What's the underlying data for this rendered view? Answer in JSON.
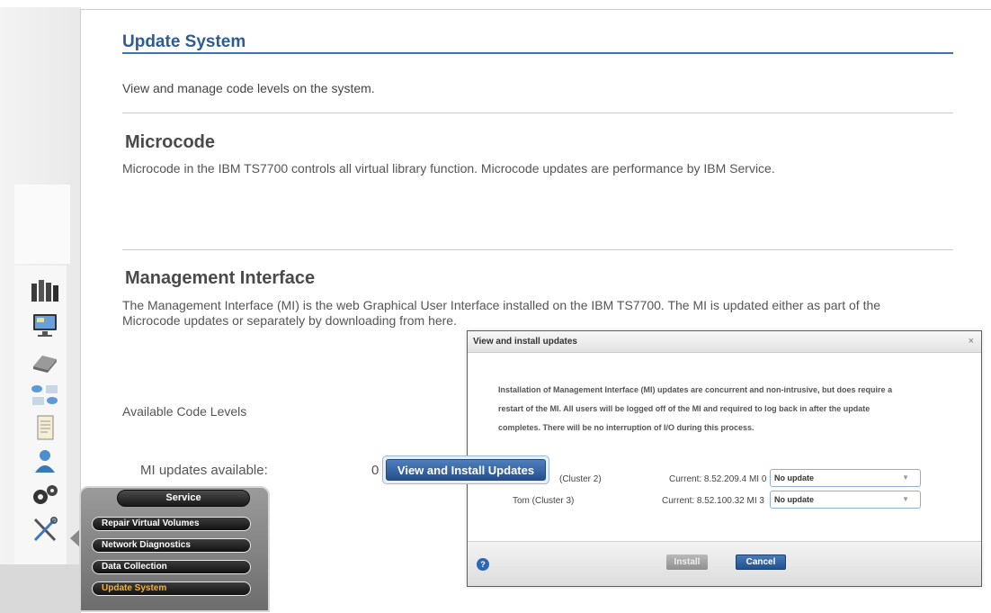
{
  "page": {
    "title": "Update System",
    "subtitle": "View and manage code levels on the system."
  },
  "microcode": {
    "heading": "Microcode",
    "description": "Microcode in the IBM TS7700 controls all virtual library function. Microcode updates are performance by IBM Service."
  },
  "management_interface": {
    "heading": "Management Interface",
    "description_line1": "The Management Interface (MI) is the web Graphical User Interface installed on the IBM TS7700. The MI is updated either as part of the",
    "description_line2": "Microcode updates or separately by downloading from here."
  },
  "code_levels": {
    "label": "Available Code Levels",
    "mi_updates_label": "MI updates available:",
    "mi_updates_count": "0",
    "view_button": "View and Install Updates"
  },
  "dialog": {
    "title": "View and install updates",
    "close": "×",
    "message_line1": "Installation of Management Interface (MI) updates are concurrent and non-intrusive, but does require a",
    "message_line2": "restart of the MI. All users will be logged off of the MI and required to log back in after the update",
    "message_line3": "completes. There will be no interruption of I/O during this process.",
    "rows": [
      {
        "name": "(Cluster 2)",
        "current": "Current: 8.52.209.4 MI 0",
        "selected": "No update"
      },
      {
        "name": "Tom (Cluster 3)",
        "current": "Current: 8.52.100.32 MI 3",
        "selected": "No update"
      }
    ],
    "help": "?",
    "install_label": "Install",
    "cancel_label": "Cancel"
  },
  "service_menu": {
    "title": "Service",
    "items": [
      "Repair Virtual Volumes",
      "Network Diagnostics",
      "Data Collection",
      "Update System"
    ],
    "active_color": "#ffb21a"
  },
  "nav_icons": [
    "cluster-icon",
    "monitor-icon",
    "cartridge-icon",
    "volumes-icon",
    "report-icon",
    "user-icon",
    "settings-icon",
    "service-tools-icon"
  ],
  "colors": {
    "title_blue": "#2b5d94",
    "dialog_border": "#2e68b4",
    "button_blue": "#254f8d"
  }
}
